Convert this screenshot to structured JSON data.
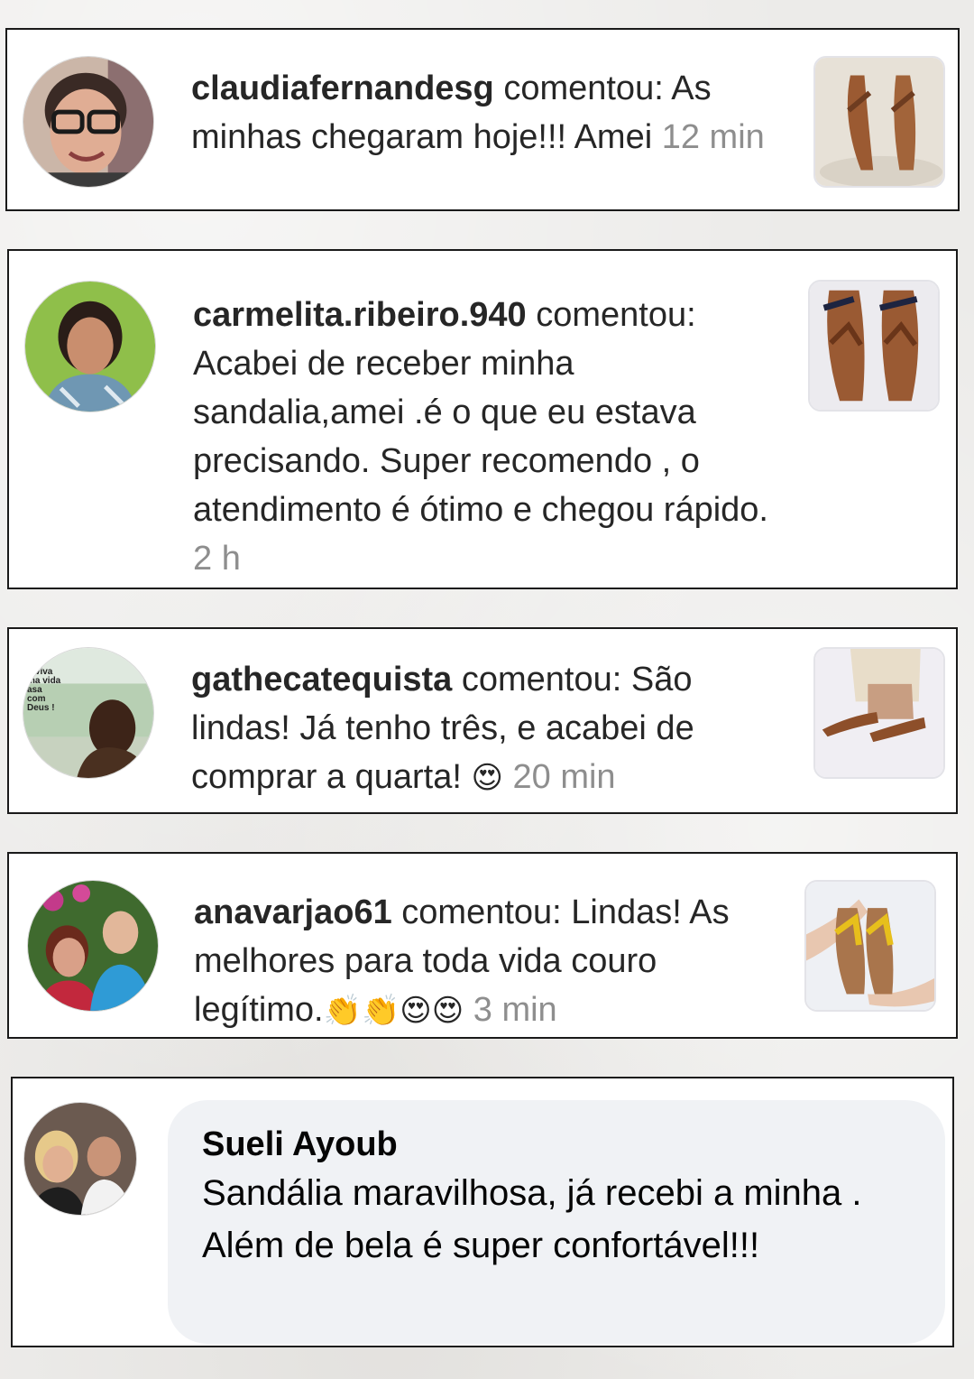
{
  "comments": [
    {
      "username": "claudiafernandesg",
      "action": " comentou: ",
      "text": "As minhas chegaram hoje!!! Amei",
      "time": "12 min",
      "avatar_icon": "avatar-photo-woman-glasses",
      "thumbnail_icon": "sandal-product-photo"
    },
    {
      "username": "carmelita.ribeiro.940",
      "action": " comentou: ",
      "text": "Acabei de receber minha sandalia,amei .é  o que eu estava precisando. Super recomendo , o atendimento  é  ótimo  e chegou rápido.",
      "time": "2 h",
      "avatar_icon": "avatar-photo-woman",
      "thumbnail_icon": "sandal-product-photo"
    },
    {
      "username": "gathecatequista",
      "action": " comentou: ",
      "text": "São lindas! Já tenho três, e acabei de comprar a quarta!",
      "emojis": "😍",
      "time": "20 min",
      "avatar_icon": "avatar-photo-woman-landscape",
      "avatar_text": "o viva ma vida asa com Deus !",
      "thumbnail_icon": "sandal-worn-photo"
    },
    {
      "username": "anavarjao61",
      "action": " comentou: ",
      "text": "Lindas! As melhores para toda vida couro legítimo.",
      "emojis": "👏👏😍😍",
      "time": "3 min",
      "avatar_icon": "avatar-photo-woman-child",
      "thumbnail_icon": "sandal-yellow-photo"
    }
  ],
  "facebook_comment": {
    "name": "Sueli Ayoub",
    "text": "Sandália maravilhosa,  já recebi a minha .\nAlém de bela é super confortável!!!",
    "avatar_icon": "avatar-photo-couple"
  }
}
